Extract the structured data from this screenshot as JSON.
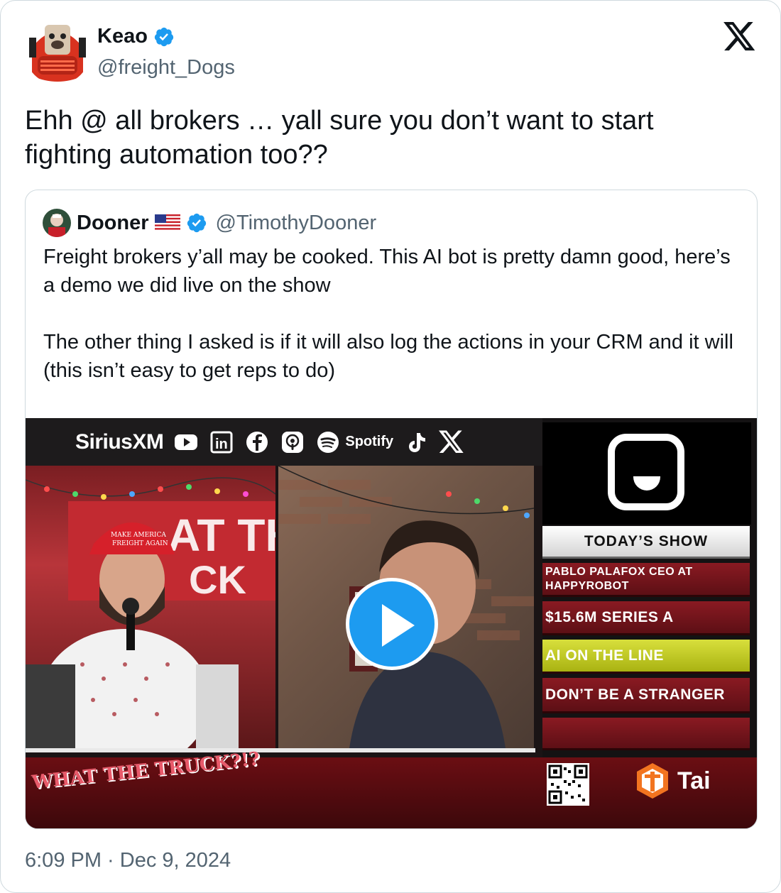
{
  "author": {
    "name": "Keao",
    "handle": "@freight_Dogs",
    "verified": true
  },
  "tweet": {
    "text": "Ehh @ all brokers … yall sure you don’t want to start fighting automation too??",
    "timestamp": "6:09 PM · Dec 9, 2024"
  },
  "quoted": {
    "name": "Dooner",
    "handle": "@TimothyDooner",
    "verified": true,
    "flag_icon": "us-flag-icon",
    "text": "Freight brokers y’all may be cooked. This AI bot is pretty damn good, here’s a demo we did live on the show\n\nThe other thing I asked is if it will also log the actions in your CRM and it will (this isn’t easy to get reps to do)"
  },
  "video": {
    "top_bar": {
      "sirius": "SiriusXM",
      "spotify": "Spotify",
      "icons": [
        "youtube-icon",
        "linkedin-icon",
        "facebook-icon",
        "podcasts-icon",
        "spotify-icon",
        "tiktok-icon",
        "x-icon"
      ]
    },
    "today_label": "TODAY’S SHOW",
    "lower_thirds": [
      "PABLO PALAFOX CEO AT HAPPYROBOT",
      "$15.6M SERIES A",
      "AI ON THE LINE",
      "DON’T BE A STRANGER"
    ],
    "hat_text": "MAKE AMERICA FREIGHT AGAIN",
    "show_logo": "WHAT THE TRUCK?!?",
    "sponsor": "Tai"
  },
  "colors": {
    "accent_blue": "#1d9bf0",
    "secondary_text": "#536471",
    "border": "#cfd9de"
  }
}
